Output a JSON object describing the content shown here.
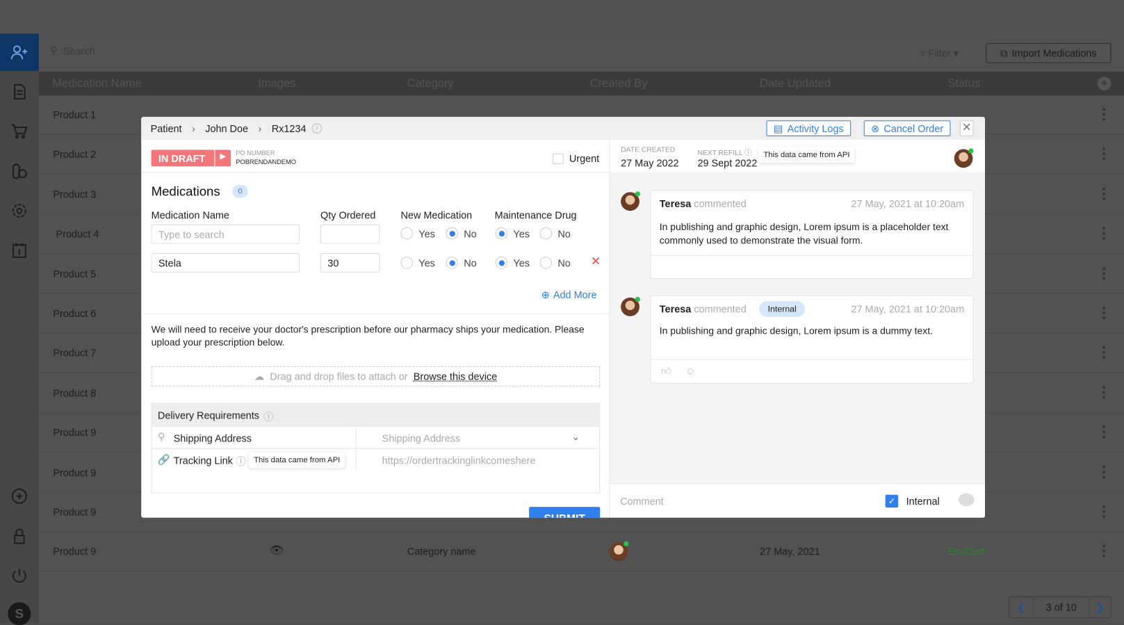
{
  "toolbar": {
    "search_placeholder": "Search",
    "filter_label": "Filter",
    "import_label": "Import Medications"
  },
  "table": {
    "headers": [
      "Medication Name",
      "Images",
      "Category",
      "Created By",
      "Date Updated",
      "Status"
    ],
    "rows": [
      {
        "name": "Product 1"
      },
      {
        "name": "Product 2"
      },
      {
        "name": "Product 3"
      },
      {
        "name": "Product 4"
      },
      {
        "name": "Product 5"
      },
      {
        "name": "Product 6"
      },
      {
        "name": "Product 7"
      },
      {
        "name": "Product 8"
      },
      {
        "name": "Product 9"
      },
      {
        "name": "Product 9"
      },
      {
        "name": "Product 9"
      },
      {
        "name": "Product 9",
        "category": "Category name",
        "date": "27 May, 2021",
        "status": "Enabled"
      }
    ]
  },
  "pagination": {
    "label": "3 of 10"
  },
  "sidebar": {
    "avatar_letter": "S"
  },
  "modal": {
    "breadcrumb": [
      "Patient",
      "John Doe",
      "Rx1234"
    ],
    "activity_logs": "Activity Logs",
    "cancel_order": "Cancel Order",
    "status": "IN DRAFT",
    "po_label": "PO NUMBER",
    "po_value": "POBRENDANDEMO",
    "urgent": "Urgent",
    "medications_title": "Medications",
    "medications_count": "0",
    "columns": {
      "name": "Medication Name",
      "qty": "Qty Ordered",
      "new": "New Medication",
      "maint": "Maintenance Drug"
    },
    "name_placeholder": "Type to search",
    "rows": [
      {
        "name": "",
        "qty": "",
        "new": "No",
        "maint": "Yes"
      },
      {
        "name": "Stela",
        "qty": "30",
        "new": "No",
        "maint": "Yes"
      }
    ],
    "yes": "Yes",
    "no": "No",
    "add_more": "Add More",
    "prescription_text": "We will need to receive your doctor's prescription before our pharmacy ships your medication. Please upload your prescription below.",
    "drop_text": "Drag and drop files to attach or",
    "browse": "Browse this device",
    "delivery_title": "Delivery Requirements",
    "shipping_label": "Shipping Address",
    "shipping_placeholder": "Shipping Address",
    "tracking_label": "Tracking Link",
    "tracking_tooltip": "This data came from API",
    "tracking_placeholder": "https://ordertrackinglinkcomeshere",
    "submit": "SUBMIT",
    "date_created_label": "DATE CREATED",
    "date_created": "27 May 2022",
    "next_refill_label": "NEXT REFILL",
    "next_refill": "29 Sept 2022",
    "refill_tooltip": "This data came from API",
    "comments": [
      {
        "author": "Teresa",
        "action": "commented",
        "time": "27 May, 2021 at 10:20am",
        "text": "In publishing and graphic design, Lorem ipsum is a placeholder text commonly used to demonstrate the visual form."
      },
      {
        "author": "Teresa",
        "action": "commented",
        "badge": "Internal",
        "time": "27 May, 2021 at 10:20am",
        "text": "In publishing and graphic design, Lorem ipsum is a dummy text."
      }
    ],
    "comment_placeholder": "Comment",
    "internal_label": "Internal",
    "colors": {
      "accent": "#2f80ed",
      "draft": "#f2767a",
      "enabled": "#2e7d32"
    }
  }
}
